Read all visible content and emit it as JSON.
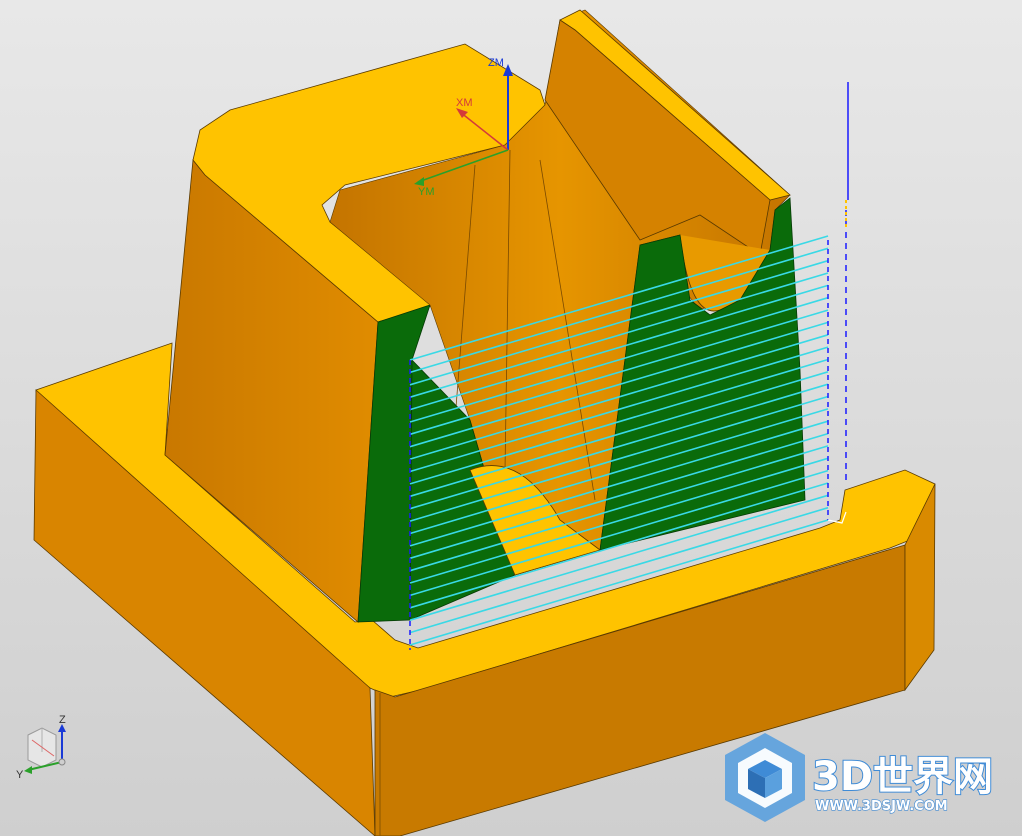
{
  "viewport": {
    "background_top": "#e6e6e6",
    "background_bottom": "#d2d2d2"
  },
  "colors": {
    "part_top": "#ffc300",
    "part_side": "#d98500",
    "part_side_dark": "#b86f00",
    "floor_face": "#0a6b0a",
    "toolpath_cut": "#39d9e6",
    "toolpath_engage": "#1a1aff",
    "wcs_x": "#d43a3a",
    "wcs_y": "#2aa02a",
    "wcs_z": "#1a3ad6"
  },
  "wcs_axes": {
    "x_label": "XM",
    "y_label": "YM",
    "z_label": "ZM"
  },
  "view_triad": {
    "z_label": "Z",
    "y_label": "Y"
  },
  "toolpath": {
    "pass_count": 24
  },
  "watermark": {
    "brand": "3D世界网",
    "url": "WWW.3DSJW.COM",
    "logo_icon": "cube-hexagon-icon"
  }
}
